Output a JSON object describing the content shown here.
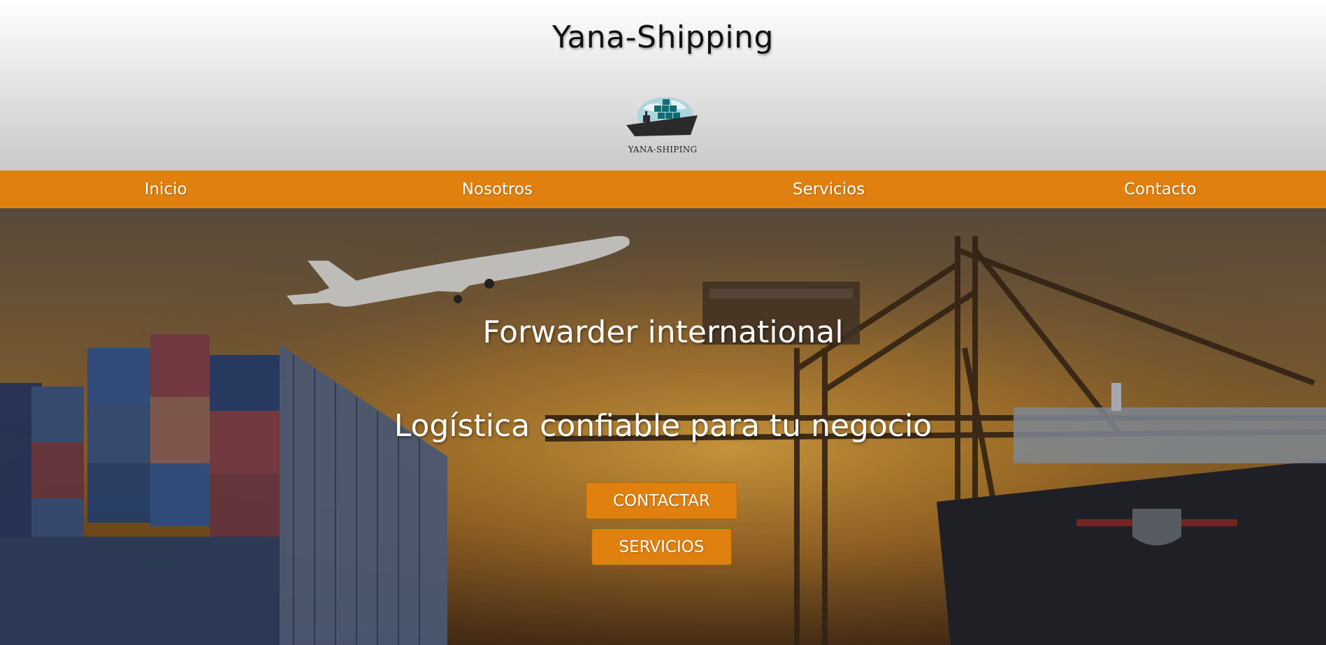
{
  "header": {
    "site_title": "Yana-Shipping",
    "logo_text": "YANA-SHIPING"
  },
  "nav": {
    "items": [
      {
        "label": "Inicio"
      },
      {
        "label": "Nosotros"
      },
      {
        "label": "Servicios"
      },
      {
        "label": "Contacto"
      }
    ]
  },
  "hero": {
    "title": "Forwarder international",
    "subtitle": "Logística confiable para tu negocio",
    "buttons": {
      "contactar": "CONTACTAR",
      "servicios": "SERVICIOS"
    }
  },
  "colors": {
    "accent": "#e0800f"
  }
}
